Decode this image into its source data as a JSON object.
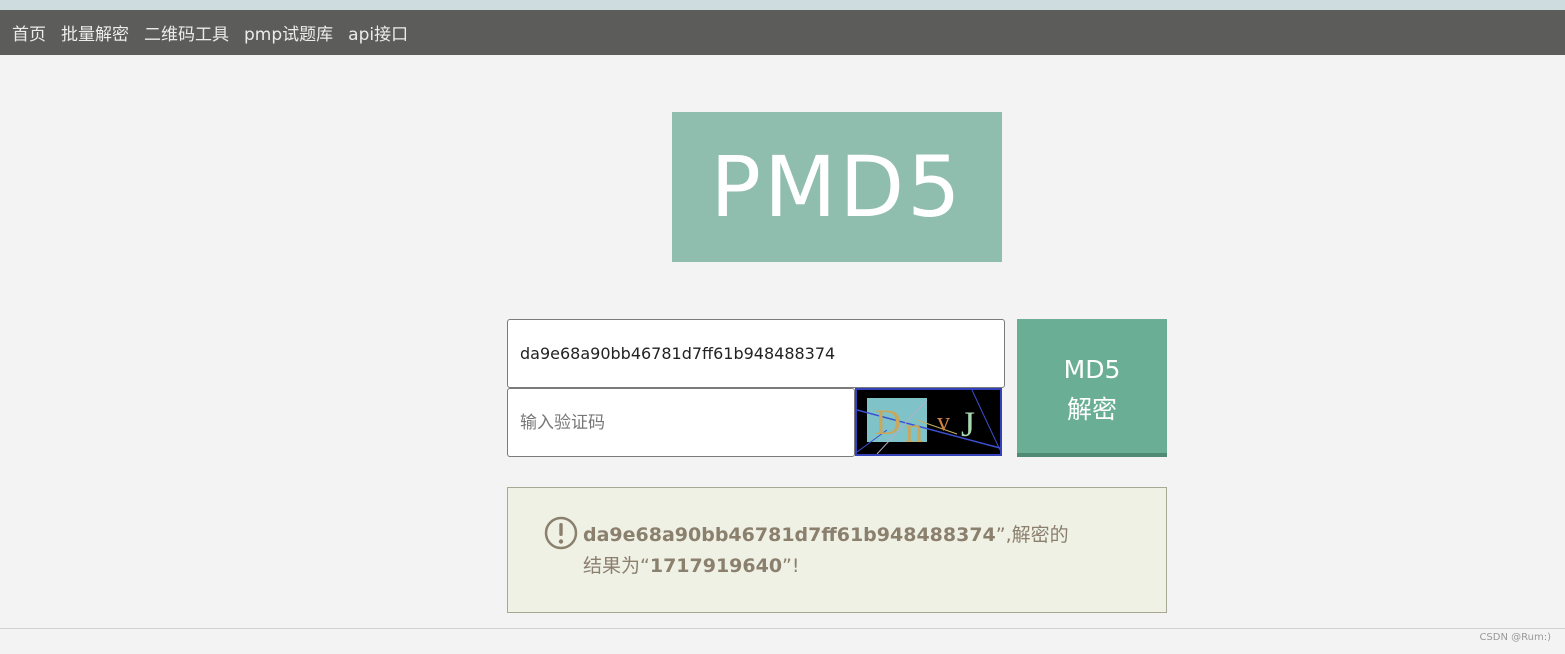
{
  "nav": {
    "items": [
      {
        "label": "首页"
      },
      {
        "label": "批量解密"
      },
      {
        "label": "二维码工具"
      },
      {
        "label": "pmp试题库"
      },
      {
        "label": "api接口"
      }
    ]
  },
  "logo": {
    "text": "PMD5"
  },
  "form": {
    "hash_value": "da9e68a90bb46781d7ff61b948488374",
    "captcha_placeholder": "输入验证码",
    "captcha_text": "DnvJ",
    "submit_line1": "MD5",
    "submit_line2": "解密"
  },
  "result": {
    "hash": "da9e68a90bb46781d7ff61b948488374",
    "text_after_hash": "”,解密的",
    "text_before_value": "结果为“",
    "value": "1717919640",
    "text_end": "”!"
  },
  "footer": {
    "watermark": "CSDN @Rum:)"
  },
  "colors": {
    "navbar": "#5c5c5a",
    "logo_bg": "#8fbdae",
    "button_bg": "#6aae96",
    "result_bg": "#eff1e4",
    "result_text": "#8b7f6e"
  }
}
